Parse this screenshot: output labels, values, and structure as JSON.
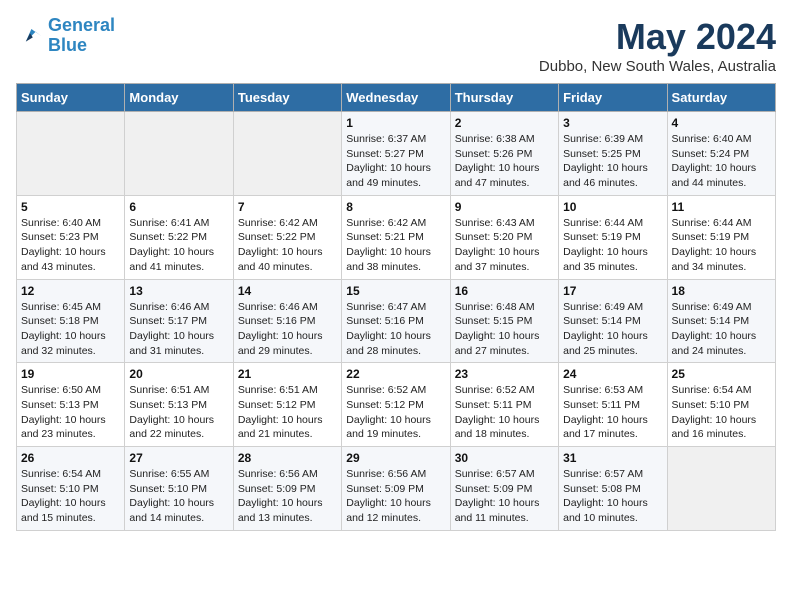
{
  "logo": {
    "line1": "General",
    "line2": "Blue"
  },
  "title": "May 2024",
  "subtitle": "Dubbo, New South Wales, Australia",
  "days_of_week": [
    "Sunday",
    "Monday",
    "Tuesday",
    "Wednesday",
    "Thursday",
    "Friday",
    "Saturday"
  ],
  "weeks": [
    [
      {
        "day": "",
        "info": ""
      },
      {
        "day": "",
        "info": ""
      },
      {
        "day": "",
        "info": ""
      },
      {
        "day": "1",
        "info": "Sunrise: 6:37 AM\nSunset: 5:27 PM\nDaylight: 10 hours\nand 49 minutes."
      },
      {
        "day": "2",
        "info": "Sunrise: 6:38 AM\nSunset: 5:26 PM\nDaylight: 10 hours\nand 47 minutes."
      },
      {
        "day": "3",
        "info": "Sunrise: 6:39 AM\nSunset: 5:25 PM\nDaylight: 10 hours\nand 46 minutes."
      },
      {
        "day": "4",
        "info": "Sunrise: 6:40 AM\nSunset: 5:24 PM\nDaylight: 10 hours\nand 44 minutes."
      }
    ],
    [
      {
        "day": "5",
        "info": "Sunrise: 6:40 AM\nSunset: 5:23 PM\nDaylight: 10 hours\nand 43 minutes."
      },
      {
        "day": "6",
        "info": "Sunrise: 6:41 AM\nSunset: 5:22 PM\nDaylight: 10 hours\nand 41 minutes."
      },
      {
        "day": "7",
        "info": "Sunrise: 6:42 AM\nSunset: 5:22 PM\nDaylight: 10 hours\nand 40 minutes."
      },
      {
        "day": "8",
        "info": "Sunrise: 6:42 AM\nSunset: 5:21 PM\nDaylight: 10 hours\nand 38 minutes."
      },
      {
        "day": "9",
        "info": "Sunrise: 6:43 AM\nSunset: 5:20 PM\nDaylight: 10 hours\nand 37 minutes."
      },
      {
        "day": "10",
        "info": "Sunrise: 6:44 AM\nSunset: 5:19 PM\nDaylight: 10 hours\nand 35 minutes."
      },
      {
        "day": "11",
        "info": "Sunrise: 6:44 AM\nSunset: 5:19 PM\nDaylight: 10 hours\nand 34 minutes."
      }
    ],
    [
      {
        "day": "12",
        "info": "Sunrise: 6:45 AM\nSunset: 5:18 PM\nDaylight: 10 hours\nand 32 minutes."
      },
      {
        "day": "13",
        "info": "Sunrise: 6:46 AM\nSunset: 5:17 PM\nDaylight: 10 hours\nand 31 minutes."
      },
      {
        "day": "14",
        "info": "Sunrise: 6:46 AM\nSunset: 5:16 PM\nDaylight: 10 hours\nand 29 minutes."
      },
      {
        "day": "15",
        "info": "Sunrise: 6:47 AM\nSunset: 5:16 PM\nDaylight: 10 hours\nand 28 minutes."
      },
      {
        "day": "16",
        "info": "Sunrise: 6:48 AM\nSunset: 5:15 PM\nDaylight: 10 hours\nand 27 minutes."
      },
      {
        "day": "17",
        "info": "Sunrise: 6:49 AM\nSunset: 5:14 PM\nDaylight: 10 hours\nand 25 minutes."
      },
      {
        "day": "18",
        "info": "Sunrise: 6:49 AM\nSunset: 5:14 PM\nDaylight: 10 hours\nand 24 minutes."
      }
    ],
    [
      {
        "day": "19",
        "info": "Sunrise: 6:50 AM\nSunset: 5:13 PM\nDaylight: 10 hours\nand 23 minutes."
      },
      {
        "day": "20",
        "info": "Sunrise: 6:51 AM\nSunset: 5:13 PM\nDaylight: 10 hours\nand 22 minutes."
      },
      {
        "day": "21",
        "info": "Sunrise: 6:51 AM\nSunset: 5:12 PM\nDaylight: 10 hours\nand 21 minutes."
      },
      {
        "day": "22",
        "info": "Sunrise: 6:52 AM\nSunset: 5:12 PM\nDaylight: 10 hours\nand 19 minutes."
      },
      {
        "day": "23",
        "info": "Sunrise: 6:52 AM\nSunset: 5:11 PM\nDaylight: 10 hours\nand 18 minutes."
      },
      {
        "day": "24",
        "info": "Sunrise: 6:53 AM\nSunset: 5:11 PM\nDaylight: 10 hours\nand 17 minutes."
      },
      {
        "day": "25",
        "info": "Sunrise: 6:54 AM\nSunset: 5:10 PM\nDaylight: 10 hours\nand 16 minutes."
      }
    ],
    [
      {
        "day": "26",
        "info": "Sunrise: 6:54 AM\nSunset: 5:10 PM\nDaylight: 10 hours\nand 15 minutes."
      },
      {
        "day": "27",
        "info": "Sunrise: 6:55 AM\nSunset: 5:10 PM\nDaylight: 10 hours\nand 14 minutes."
      },
      {
        "day": "28",
        "info": "Sunrise: 6:56 AM\nSunset: 5:09 PM\nDaylight: 10 hours\nand 13 minutes."
      },
      {
        "day": "29",
        "info": "Sunrise: 6:56 AM\nSunset: 5:09 PM\nDaylight: 10 hours\nand 12 minutes."
      },
      {
        "day": "30",
        "info": "Sunrise: 6:57 AM\nSunset: 5:09 PM\nDaylight: 10 hours\nand 11 minutes."
      },
      {
        "day": "31",
        "info": "Sunrise: 6:57 AM\nSunset: 5:08 PM\nDaylight: 10 hours\nand 10 minutes."
      },
      {
        "day": "",
        "info": ""
      }
    ]
  ]
}
